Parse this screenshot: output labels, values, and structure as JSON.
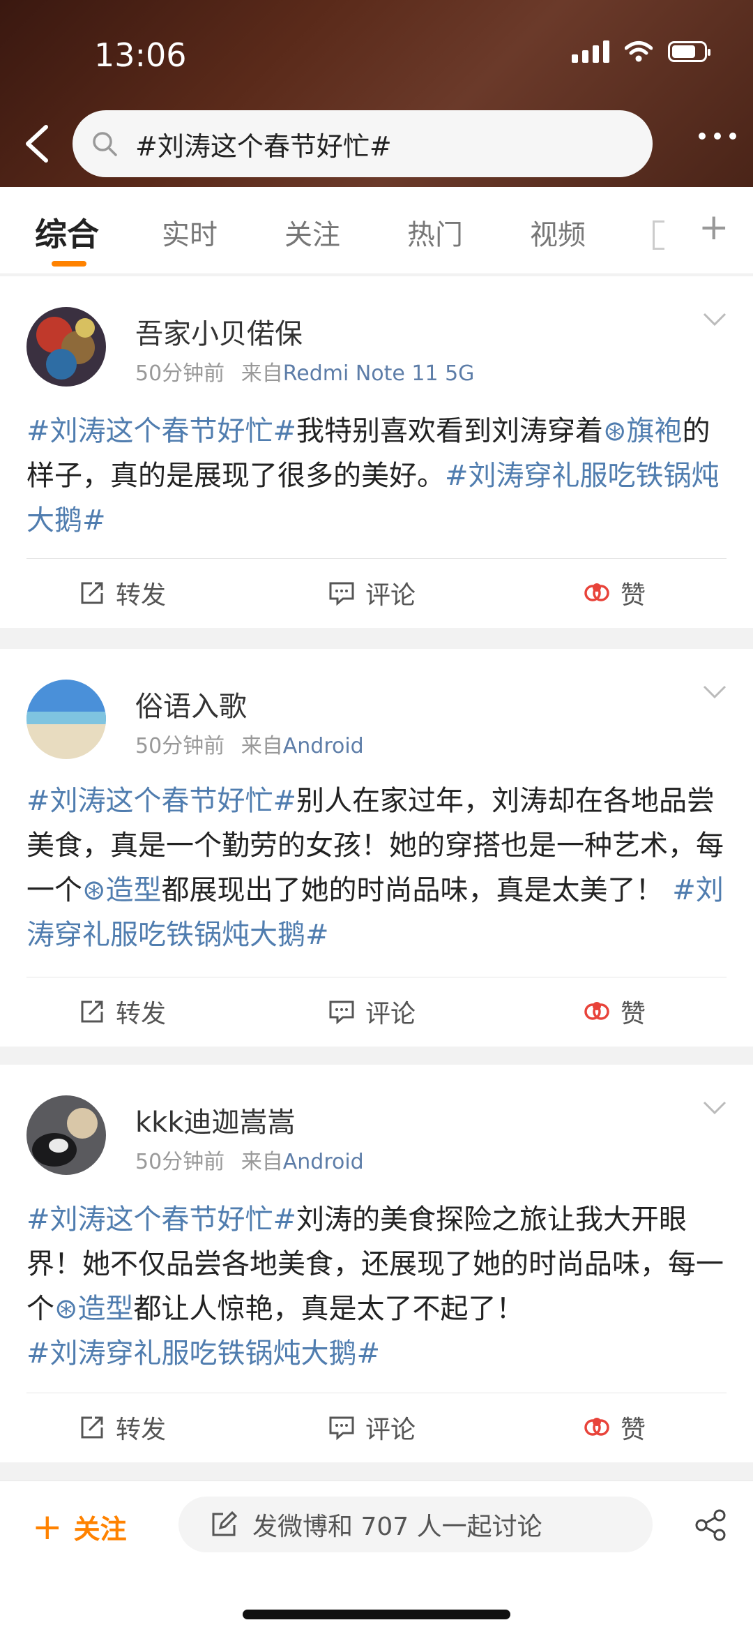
{
  "status": {
    "time": "13:06"
  },
  "search": {
    "query": "#刘涛这个春节好忙#"
  },
  "tabs": [
    "综合",
    "实时",
    "关注",
    "热门",
    "视频"
  ],
  "actions": {
    "repost": "转发",
    "comment": "评论",
    "like": "赞"
  },
  "posts": [
    {
      "username": "吾家小贝偌保",
      "time": "50分钟前",
      "source_prefix": "来自",
      "source": "Redmi Note 11 5G",
      "tag1": "#刘涛这个春节好忙#",
      "text1": "我特别喜欢看到刘涛穿着",
      "link": "旗袍",
      "text2": "的样子，真的是展现了很多的美好。",
      "tag2": "#刘涛穿礼服吃铁锅炖大鹅#"
    },
    {
      "username": "俗语入歌",
      "time": "50分钟前",
      "source_prefix": "来自",
      "source": "Android",
      "tag1": "#刘涛这个春节好忙#",
      "text1": "别人在家过年，刘涛却在各地品尝美食，真是一个勤劳的女孩！她的穿搭也是一种艺术，每一个",
      "link": "造型",
      "text2": "都展现出了她的时尚品味，真是太美了！",
      "tag2": "#刘涛穿礼服吃铁锅炖大鹅#"
    },
    {
      "username": "kkk迪迦嵩嵩",
      "time": "50分钟前",
      "source_prefix": "来自",
      "source": "Android",
      "tag1": "#刘涛这个春节好忙#",
      "text1": "刘涛的美食探险之旅让我大开眼界！她不仅品尝各地美食，还展现了她的时尚品味，每一个",
      "link": "造型",
      "text2": "都让人惊艳，真是太了不起了！",
      "tag2": "#刘涛穿礼服吃铁锅炖大鹅#"
    }
  ],
  "bottom": {
    "follow": "关注",
    "compose": "发微博和 707 人一起讨论"
  },
  "colors": {
    "accent": "#ff8200",
    "link": "#507daf",
    "like": "#e8433a"
  }
}
